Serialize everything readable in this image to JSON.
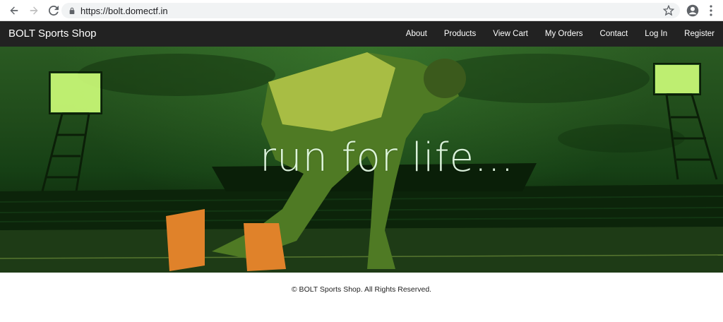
{
  "browser": {
    "url": "https://bolt.domectf.in",
    "icons": {
      "back": "back-arrow-icon",
      "forward": "forward-arrow-icon",
      "reload": "reload-icon",
      "lock": "lock-icon",
      "bookmark": "star-icon",
      "account": "account-icon",
      "menu": "kebab-menu-icon"
    }
  },
  "site": {
    "brand": "BOLT Sports Shop",
    "nav": [
      {
        "label": "About"
      },
      {
        "label": "Products"
      },
      {
        "label": "View Cart"
      },
      {
        "label": "My Orders"
      },
      {
        "label": "Contact"
      },
      {
        "label": "Log In"
      },
      {
        "label": "Register"
      }
    ]
  },
  "hero": {
    "tagline": "run for life..."
  },
  "footer": {
    "copyright": "© BOLT Sports Shop. All Rights Reserved."
  },
  "colors": {
    "navbar": "#222222",
    "hero_green": "#1f4a1a"
  }
}
